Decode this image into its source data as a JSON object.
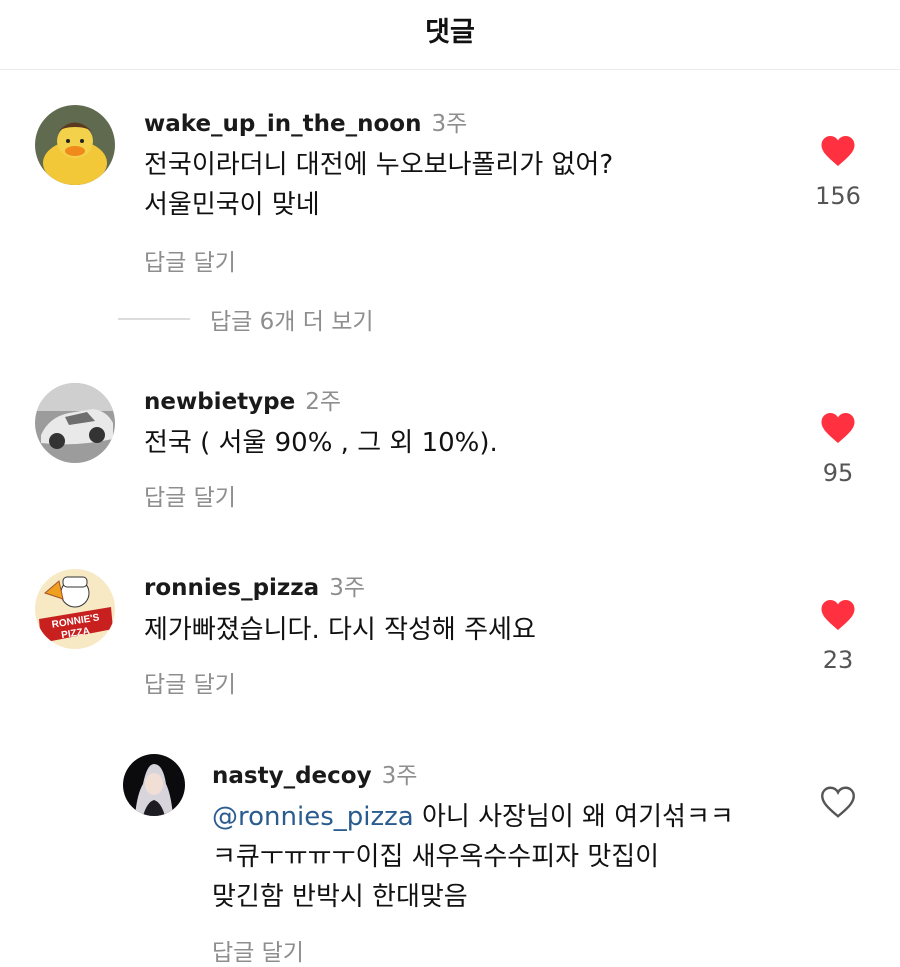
{
  "header": {
    "title": "댓글"
  },
  "comments": [
    {
      "username": "wake_up_in_the_noon",
      "time": "3주",
      "lines": [
        "전국이라더니 대전에 누오보나폴리가 없어?",
        "서울민국이 맞네"
      ],
      "reply_label": "답글 달기",
      "likes": "156",
      "liked": true,
      "view_replies": "답글 6개 더 보기"
    },
    {
      "username": "newbietype",
      "time": "2주",
      "lines": [
        "전국 ( 서울 90% , 그 외 10%)."
      ],
      "reply_label": "답글 달기",
      "likes": "95",
      "liked": true
    },
    {
      "username": "ronnies_pizza",
      "time": "3주",
      "lines": [
        "제가빠졌습니다. 다시 작성해 주세요"
      ],
      "reply_label": "답글 달기",
      "likes": "23",
      "liked": true,
      "avatar_text": [
        "RONNIE'S",
        "PIZZA"
      ]
    },
    {
      "username": "nasty_decoy",
      "time": "3주",
      "mention": "@ronnies_pizza",
      "lines": [
        " 아니 사장님이 왜 여기섞ㅋㅋ",
        "ㅋ큐ㅜㅠㅠㅜ이집 새우옥수수피자 맛집이",
        "맞긴함 반박시 한대맞음"
      ],
      "reply_label": "답글 달기",
      "liked": false
    }
  ],
  "colors": {
    "like_red": "#ff3040",
    "muted": "#8e8e8e",
    "mention": "#2a5c8f"
  },
  "icons": {
    "liked": "heart-filled-icon",
    "unliked": "heart-outline-icon"
  }
}
